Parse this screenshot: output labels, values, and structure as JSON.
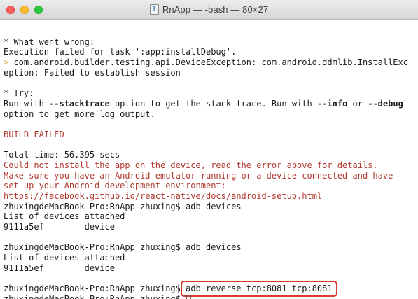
{
  "window": {
    "title": "RnApp — -bash — 80×27",
    "title_icon": "terminal-document-icon"
  },
  "terminal": {
    "lines": [
      {
        "id": "l1",
        "text": "",
        "kind": "blank"
      },
      {
        "id": "l2",
        "text": "* What went wrong:",
        "kind": "normal"
      },
      {
        "id": "l3",
        "text": "Execution failed for task ':app:installDebug'.",
        "kind": "normal"
      },
      {
        "id": "l4",
        "prefix": "> ",
        "text": "com.android.builder.testing.api.DeviceException: com.android.ddmlib.InstallExc",
        "kind": "arrow"
      },
      {
        "id": "l5",
        "text": "eption: Failed to establish session",
        "kind": "normal"
      },
      {
        "id": "l6",
        "text": "",
        "kind": "blank"
      },
      {
        "id": "l7",
        "text": "* Try:",
        "kind": "normal"
      },
      {
        "id": "l8",
        "kind": "try1",
        "parts": [
          "Run with ",
          "--stacktrace",
          " option to get the stack trace. Run with ",
          "--info",
          " or ",
          "--debug"
        ]
      },
      {
        "id": "l9",
        "text": "option to get more log output.",
        "kind": "normal"
      },
      {
        "id": "l10",
        "text": "",
        "kind": "blank"
      },
      {
        "id": "l11",
        "text": "BUILD FAILED",
        "kind": "red"
      },
      {
        "id": "l12",
        "text": "",
        "kind": "blank"
      },
      {
        "id": "l13",
        "text": "Total time: 56.395 secs",
        "kind": "normal"
      },
      {
        "id": "l14",
        "text": "Could not install the app on the device, read the error above for details.",
        "kind": "red"
      },
      {
        "id": "l15",
        "text": "Make sure you have an Android emulator running or a device connected and have",
        "kind": "red"
      },
      {
        "id": "l16",
        "text": "set up your Android development environment:",
        "kind": "red"
      },
      {
        "id": "l17",
        "text": "https://facebook.github.io/react-native/docs/android-setup.html",
        "kind": "red"
      },
      {
        "id": "l18",
        "text": "zhuxingdeMacBook-Pro:RnApp zhuxing$ adb devices",
        "kind": "normal"
      },
      {
        "id": "l19",
        "text": "List of devices attached",
        "kind": "normal"
      },
      {
        "id": "l20",
        "text": "9111a5ef        device",
        "kind": "normal"
      },
      {
        "id": "l21",
        "text": "",
        "kind": "blank"
      },
      {
        "id": "l22",
        "text": "zhuxingdeMacBook-Pro:RnApp zhuxing$ adb devices",
        "kind": "normal"
      },
      {
        "id": "l23",
        "text": "List of devices attached",
        "kind": "normal"
      },
      {
        "id": "l24",
        "text": "9111a5ef        device",
        "kind": "normal"
      },
      {
        "id": "l25",
        "text": "",
        "kind": "blank"
      },
      {
        "id": "l26",
        "kind": "highlighted",
        "prompt": "zhuxingdeMacBook-Pro:RnApp zhuxing$ ",
        "command": "adb reverse tcp:8081 tcp:8081"
      },
      {
        "id": "l27",
        "kind": "current",
        "prompt": "zhuxingdeMacBook-Pro:RnApp zhuxing$ "
      }
    ]
  },
  "colors": {
    "error_red": "#b0382e",
    "highlight_border": "#d93a30",
    "arrow_yellow": "#c8a23a"
  }
}
